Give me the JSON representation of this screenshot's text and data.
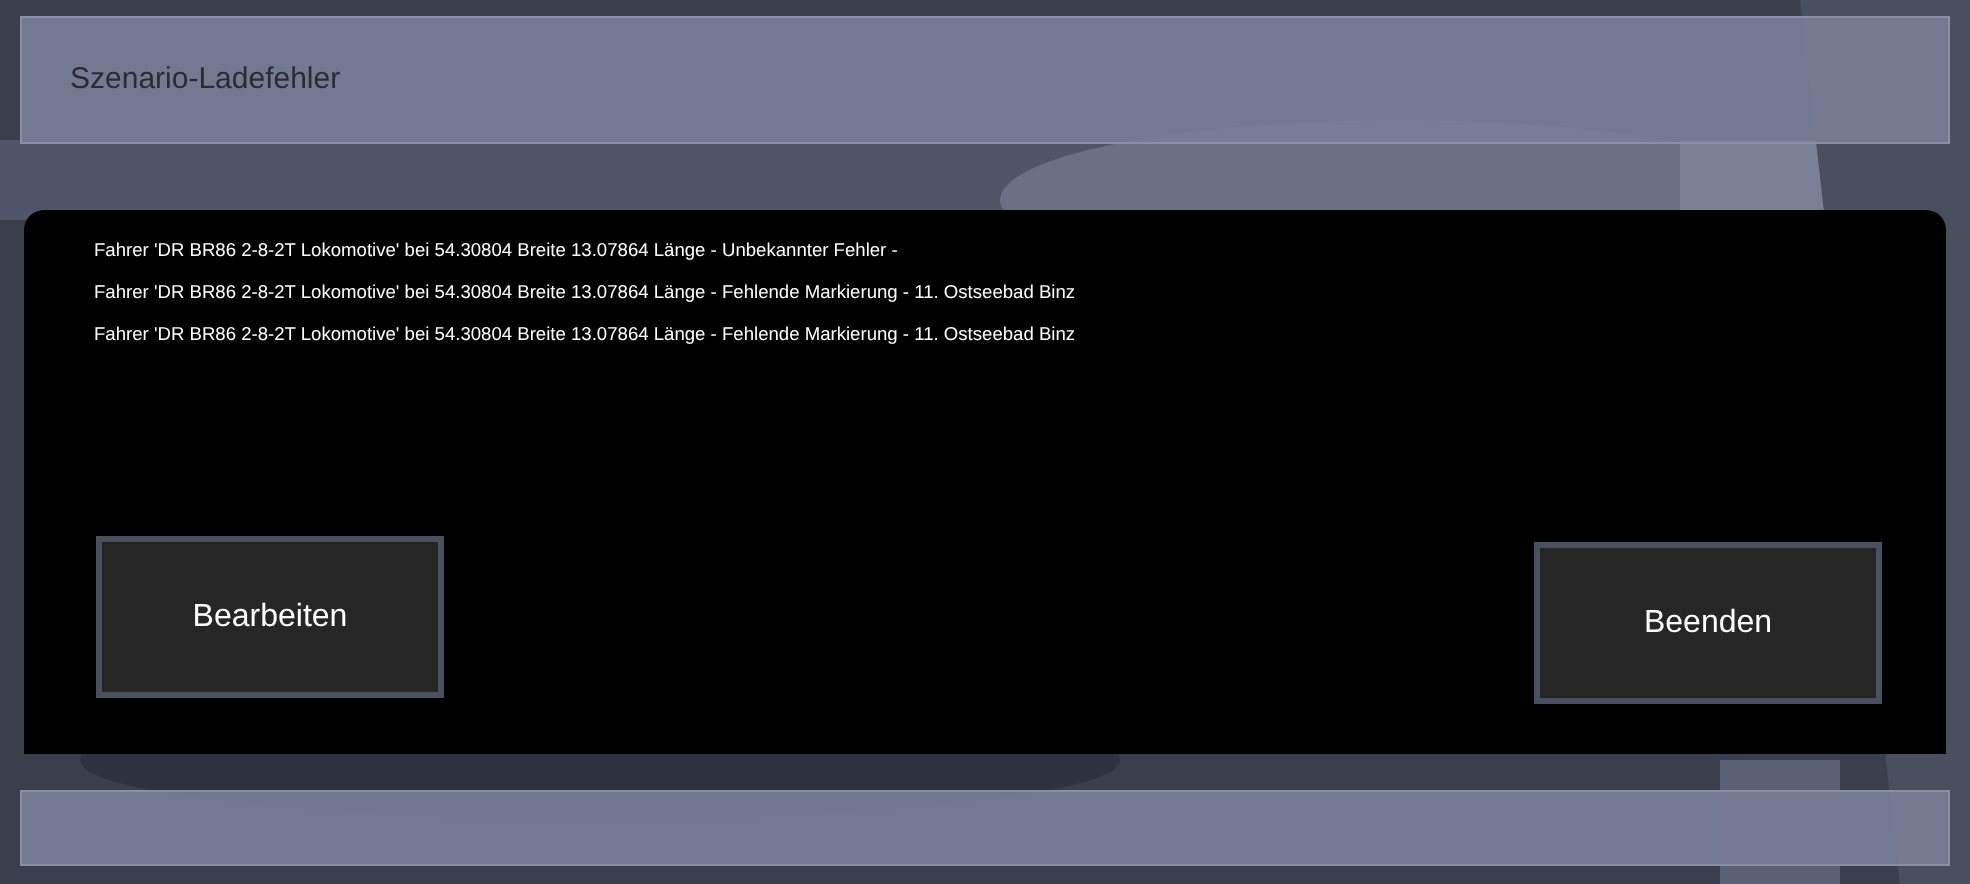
{
  "dialog": {
    "title": "Szenario-Ladefehler"
  },
  "errors": [
    "Fahrer 'DR BR86 2-8-2T Lokomotive' bei 54.30804 Breite 13.07864 Länge - Unbekannter Fehler -",
    "Fahrer 'DR BR86 2-8-2T Lokomotive' bei 54.30804 Breite 13.07864 Länge - Fehlende Markierung - 11. Ostseebad Binz",
    "Fahrer 'DR BR86 2-8-2T Lokomotive' bei 54.30804 Breite 13.07864 Länge - Fehlende Markierung - 11. Ostseebad Binz"
  ],
  "buttons": [
    "Bearbeiten",
    "Beenden"
  ]
}
